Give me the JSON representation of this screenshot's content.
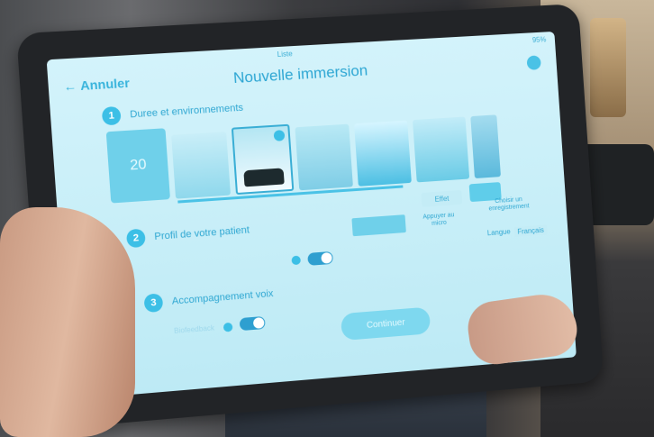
{
  "app": {
    "title": "Nouvelle immersion",
    "back_label": "Annuler",
    "cloud_label": "Liste",
    "status": [
      "95%"
    ]
  },
  "steps": [
    {
      "number": "1",
      "label": "Duree et environnements"
    },
    {
      "number": "2",
      "label": "Profil de votre patient"
    },
    {
      "number": "3",
      "label": "Accompagnement voix"
    }
  ],
  "duration": {
    "value": "20"
  },
  "buttons": {
    "effect": "Effet",
    "mic": "Appuyer au micro",
    "record": "Choisir un enregistrement",
    "continue": "Continuer"
  },
  "language": {
    "label": "Langue",
    "value": "Français"
  },
  "biofeedback_label": "Biofeedback",
  "colors": {
    "accent": "#3cbfe6",
    "screen_bg": "#c9eef8"
  }
}
